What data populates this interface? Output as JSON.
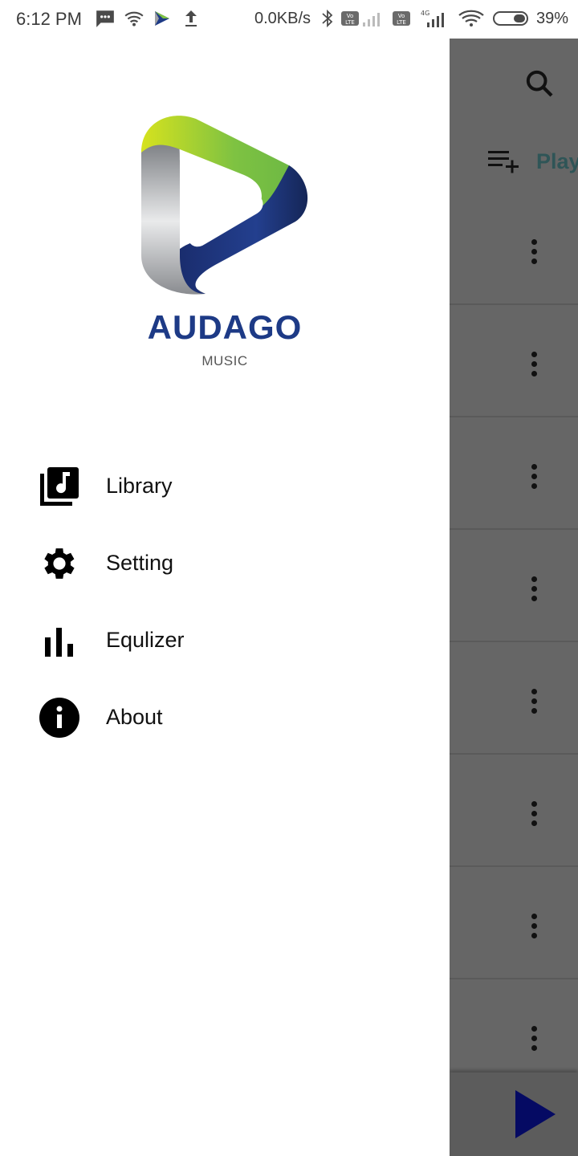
{
  "status_bar": {
    "time": "6:12 PM",
    "net_speed": "0.0KB/s",
    "battery": "39%",
    "icons": [
      "message-icon",
      "wifi-hotspot-icon",
      "audago-app-icon",
      "upload-icon",
      "bluetooth-icon",
      "volte-icon",
      "signal-icon",
      "volte-4g-icon",
      "signal-4g-icon",
      "wifi-icon",
      "battery-icon"
    ]
  },
  "drawer": {
    "brand_name": "AUDAGO",
    "brand_subtitle": "MUSIC",
    "menu": [
      {
        "label": "Library",
        "icon": "library-music-icon"
      },
      {
        "label": "Setting",
        "icon": "gear-icon"
      },
      {
        "label": "Equlizer",
        "icon": "equalizer-icon"
      },
      {
        "label": "About",
        "icon": "info-icon"
      }
    ]
  },
  "background": {
    "playlist_label": "Play",
    "row_count": 8,
    "colors": {
      "scrim": "#666666",
      "play_button": "#050a63"
    }
  },
  "colors": {
    "brand_blue": "#1d3a86",
    "logo_green": "#7ec242",
    "logo_yellow": "#d6e21e",
    "logo_gray": "#9a9ca0"
  }
}
